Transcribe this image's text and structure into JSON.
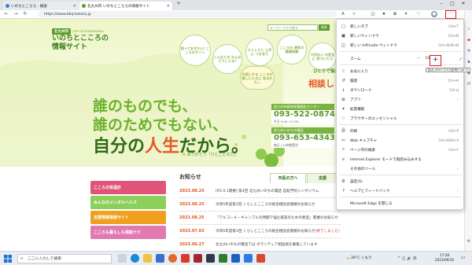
{
  "tabs": [
    {
      "title": "いのちところろ - 検索",
      "icon_color": "#3b7bd8",
      "active": false
    },
    {
      "title": "北九州市 いのちところろの情報サイト",
      "icon_color": "#5a9b2c",
      "active": true
    }
  ],
  "address": {
    "url": "https://www.kbq-kokoro.jp"
  },
  "site": {
    "city_badge": "北九州市",
    "city_en": "CITY OF KITAKYUSHU",
    "title": "いのちとこころの情報サイト",
    "search_placeholder": "キーワードから探す",
    "search_button": "検索",
    "bubbles": [
      "知っておきたい! こころのサイン",
      "こんなとき みんな どうしてる?",
      "ストレスと 上手に つきあう",
      "こころの 病気の 基礎知識",
      "大切な人 の変化に 気づいたら",
      "元気にする こころが楽しいときに あるから…"
    ],
    "slogan1": "誰のものでも、",
    "slogan2": "誰のためでもない、",
    "slogan3a": "自分の",
    "slogan3b": "人生",
    "slogan3c": "だから。",
    "hitori": "ひとりで悩まず",
    "sodan": "相談しましょう",
    "card1_header": "北九州市精神保健福祉センター",
    "card1_num": "093-522-0874",
    "card1_sub": "平日 9:00~17:00",
    "card2_header": "北九州いのちの電話",
    "card2_num": "093-653-4343",
    "card2_sub": "毎日 | 24時間受付",
    "arigatou": "ありがとう「ひとことの力」",
    "banners": [
      {
        "label": "こころの体温計",
        "color": "#e05577"
      },
      {
        "label": "みんなのメンタルヘルス",
        "color": "#8ccf5c"
      },
      {
        "label": "支援情報検索サイト",
        "color": "#f0a020"
      },
      {
        "label": "こころも暮らしも相談ナビ",
        "color": "#e07ab0"
      }
    ],
    "news_title": "お知らせ",
    "news_tab_citizen": "市民の方へ",
    "news_tab_support": "支援",
    "news": [
      {
        "date": "2023.08.25",
        "text": "[R5.9.1開催] 第4回 北九州いのちの電話 自殺予防シンポジウム"
      },
      {
        "date": "2023.08.25",
        "text": "令和5年度第2回 くらしとこころの総合相談会開催のお知らせ"
      },
      {
        "date": "2023.08.25",
        "text": "「アルコール・ギャンブルの問題で悩む家族のための教室」開催のお知らせ"
      },
      {
        "date": "2023.07.03",
        "text": "令和5年度第1回 くらしとこころの総合相談会開催のお知らせ",
        "suffix": "(終了しました)"
      },
      {
        "date": "2023.06.27",
        "text": "北九州いのちの電話では ボランティア相談員を募集しています"
      }
    ]
  },
  "menu": {
    "items": [
      {
        "label": "新しいタブ",
        "shortcut": "Ctrl+T",
        "icon": "new-tab-icon",
        "glyph": "▢"
      },
      {
        "label": "新しいウィンドウ",
        "shortcut": "Ctrl+N",
        "icon": "new-window-icon",
        "glyph": "▣"
      },
      {
        "label": "新しい InPrivate ウィンドウ",
        "shortcut": "Ctrl+Shift+N",
        "icon": "inprivate-icon",
        "glyph": "◫"
      },
      {
        "label": "ズーム",
        "shortcut": "",
        "icon": "",
        "glyph": ""
      },
      {
        "label": "お気に入り",
        "shortcut": "Ctrl+Shift+O",
        "icon": "favorites-icon",
        "glyph": "☆"
      },
      {
        "label": "履歴",
        "shortcut": "Ctrl+H",
        "icon": "history-icon",
        "glyph": "↺"
      },
      {
        "label": "ダウンロード",
        "shortcut": "Ctrl+J",
        "icon": "download-icon",
        "glyph": "↓"
      },
      {
        "label": "アプリ",
        "shortcut": "",
        "icon": "apps-icon",
        "glyph": "⊞",
        "arrow": true
      },
      {
        "label": "拡張機能",
        "shortcut": "",
        "icon": "extensions-icon",
        "glyph": "✦"
      },
      {
        "label": "ブラウザーのエッセンシャル",
        "shortcut": "",
        "icon": "essentials-icon",
        "glyph": "♡"
      },
      {
        "label": "印刷",
        "shortcut": "Ctrl+P",
        "icon": "print-icon",
        "glyph": "⎙"
      },
      {
        "label": "Web キャプチャ",
        "shortcut": "Ctrl+Shift+S",
        "icon": "capture-icon",
        "glyph": "✂"
      },
      {
        "label": "ページ内の検索",
        "shortcut": "Ctrl+F",
        "icon": "find-icon",
        "glyph": "⌕"
      },
      {
        "label": "Internet Explorer モードで再読み込みする",
        "shortcut": "",
        "icon": "ie-icon",
        "glyph": "e"
      },
      {
        "label": "その他のツール",
        "shortcut": "",
        "icon": "",
        "glyph": "",
        "arrow": true
      },
      {
        "label": "設定(S)",
        "shortcut": "",
        "icon": "settings-icon",
        "glyph": "⚙"
      },
      {
        "label": "ヘルプとフィードバック",
        "shortcut": "",
        "icon": "help-icon",
        "glyph": "?",
        "arrow": true
      },
      {
        "label": "Microsoft Edge を閉じる",
        "shortcut": "",
        "icon": "",
        "glyph": ""
      }
    ],
    "zoom_value": "100%",
    "zoom_minus": "—",
    "zoom_plus": "+",
    "zoom_tooltip": "拡大 (Ctrl+プラス記号(+)キー)"
  },
  "taskbar": {
    "search_placeholder": "ここに入力して検索",
    "weather": "26°C くもり",
    "time": "17:28",
    "date": "2023/09/16"
  }
}
